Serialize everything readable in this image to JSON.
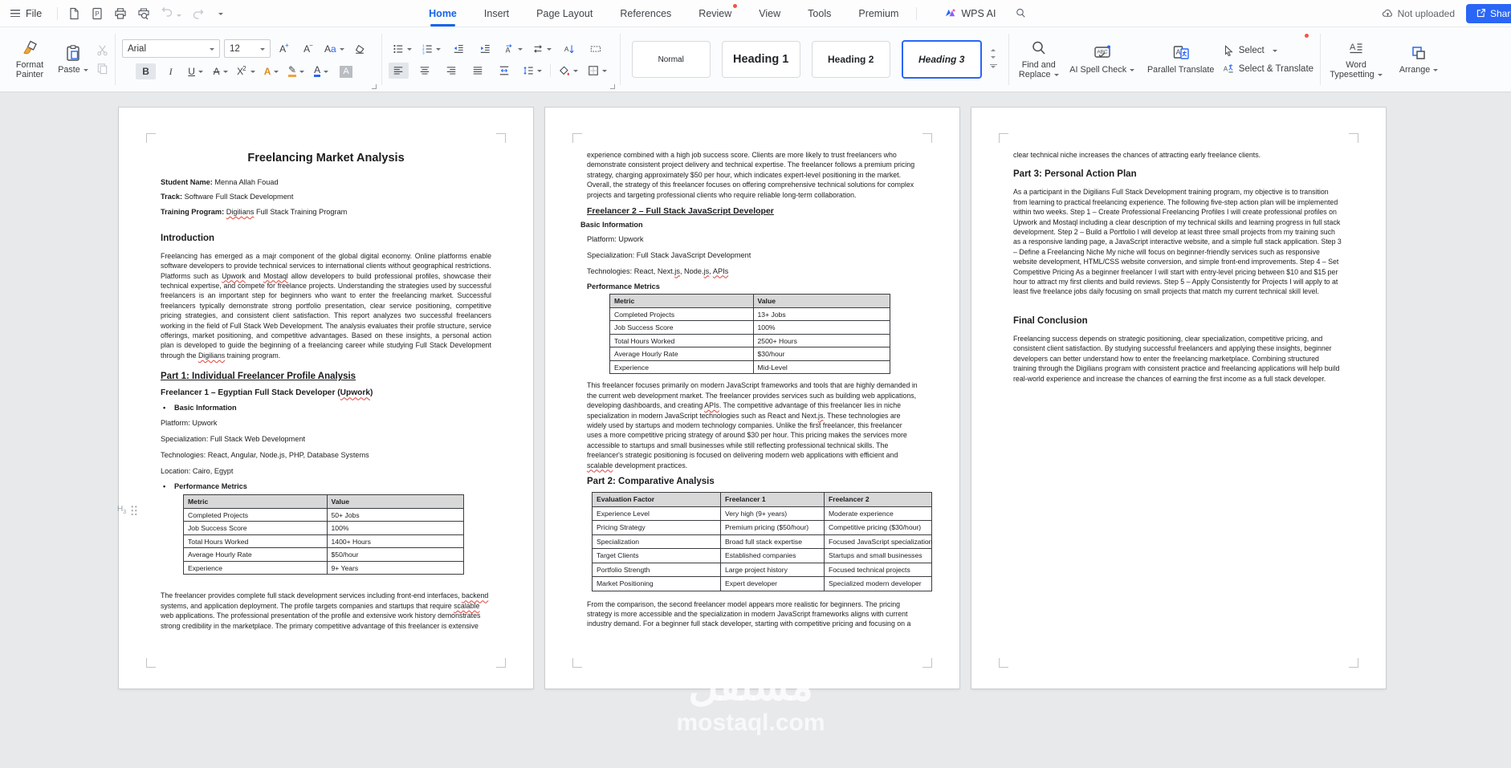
{
  "titlebar": {
    "file_label": "File",
    "tabs": [
      {
        "label": "Home",
        "active": true
      },
      {
        "label": "Insert"
      },
      {
        "label": "Page Layout"
      },
      {
        "label": "References"
      },
      {
        "label": "Review",
        "badge_dot": true
      },
      {
        "label": "View"
      },
      {
        "label": "Tools"
      },
      {
        "label": "Premium"
      }
    ],
    "wps_ai_label": "WPS AI",
    "upload_status": "Not uploaded",
    "share_label": "Share"
  },
  "ribbon": {
    "format_painter": "Format Painter",
    "paste": "Paste",
    "font_family": "Arial",
    "font_size": "12",
    "styles": [
      {
        "name": "Normal"
      },
      {
        "name": "Heading 1"
      },
      {
        "name": "Heading 2"
      },
      {
        "name": "Heading 3",
        "selected": true
      }
    ],
    "find_replace": "Find and Replace",
    "ai_spell_check": "AI Spell Check",
    "parallel_translate": "Parallel Translate",
    "select": "Select",
    "select_translate": "Select & Translate",
    "word_typesetting": "Word Typesetting",
    "arrange": "Arrange"
  },
  "margin_marker": "H3",
  "watermark": {
    "arabic": "مستقل",
    "latin": "mostaql.com"
  },
  "doc": {
    "page1": {
      "title": "Freelancing Market Analysis",
      "meta": [
        "**Student Name:** Menna Allah Fouad",
        "**Track:** Software Full Stack Development",
        "**Training Program:** «Digilians» Full Stack Training Program"
      ],
      "intro_heading": "Introduction",
      "intro": "Freelancing has emerged as a majr component of the global digital economy. Online platforms enable software developers to provide technical services to international clients without geographical restrictions. Platforms such as «Upwork» and «Mostaql» allow developers to build professional profiles, showcase their technical expertise, and compete for freelance projects. Understanding the strategies used by successful freelancers is an important step for beginners who want to enter the freelancing market. Successful freelancers typically demonstrate strong portfolio presentation, clear service positioning, competitive pricing strategies, and consistent client satisfaction. This report analyzes two successful freelancers working in the field of Full Stack Web Development. The analysis evaluates their profile structure, service offerings, market positioning, and competitive advantages. Based on these insights, a personal action plan is developed to guide the beginning of a freelancing career while studying Full Stack Development through the «Digilians» training program.",
      "part1_heading": "Part 1: Individual Freelancer Profile Analysis",
      "freelancer1_heading": "Freelancer 1 – Egyptian Full Stack Developer («Upwork»)",
      "basic_info_label": "Basic Information",
      "info": [
        "Platform: Upwork",
        "Specialization: Full Stack Web Development",
        "Technologies: React, Angular, Node.js, PHP, Database Systems",
        "Location: Cairo, Egypt"
      ],
      "metrics_label": "Performance Metrics",
      "metrics_table": {
        "headers": [
          "Metric",
          "Value"
        ],
        "rows": [
          [
            "Completed Projects",
            "50+ Jobs"
          ],
          [
            "Job Success Score",
            "100%"
          ],
          [
            "Total Hours Worked",
            "1400+ Hours"
          ],
          [
            "Average Hourly Rate",
            "$50/hour"
          ],
          [
            "Experience",
            "9+ Years"
          ]
        ]
      },
      "closing": "The freelancer provides complete full stack development services including front-end interfaces, «backend» systems, and application deployment. The profile targets companies and startups that require «scalable» web applications. The professional presentation of the profile and extensive work history demonstrates strong credibility in the marketplace. The primary competitive advantage of this freelancer is extensive"
    },
    "page2": {
      "continuation": "experience combined with a high job success score. Clients are more likely to trust freelancers who demonstrate consistent project delivery and technical expertise. The freelancer follows a premium pricing strategy, charging approximately $50 per hour, which indicates expert-level positioning in the market. Overall, the strategy of this freelancer focuses on offering comprehensive technical solutions for complex projects and targeting professional clients who require reliable long-term collaboration.",
      "freelancer2_heading": "Freelancer 2 – Full Stack JavaScript Developer",
      "basic_info_label": "Basic Information",
      "info": [
        "Platform: Upwork",
        "Specialization: Full Stack JavaScript Development",
        "Technologies: React, Next.«js», Node.«js», «APIs»"
      ],
      "metrics_label": "Performance Metrics",
      "metrics_table": {
        "headers": [
          "Metric",
          "Value"
        ],
        "rows": [
          [
            "Completed Projects",
            "13+ Jobs"
          ],
          [
            "Job Success Score",
            "100%"
          ],
          [
            "Total Hours Worked",
            "2500+ Hours"
          ],
          [
            "Average Hourly Rate",
            "$30/hour"
          ],
          [
            "Experience",
            "Mid-Level"
          ]
        ]
      },
      "analysis": "This freelancer focuses primarily on modern JavaScript frameworks and tools that are highly demanded in the current web development market. The freelancer provides services such as building web applications, developing dashboards, and creating «APIs». The competitive advantage of this freelancer lies in niche specialization in modern JavaScript technologies such as React and Next.«js». These technologies are widely used by startups and modern technology companies. Unlike the first freelancer, this freelancer uses a more competitive pricing strategy of around $30 per hour. This pricing makes the services more accessible to startups and small businesses while still reflecting professional technical skills. The freelancer's strategic positioning is focused on delivering modern web applications with efficient and «scalable» development practices.",
      "part2_heading": "Part 2: Comparative Analysis",
      "comparison_table": {
        "headers": [
          "Evaluation Factor",
          "Freelancer 1",
          "Freelancer 2"
        ],
        "rows": [
          [
            "Experience Level",
            "Very high (9+ years)",
            "Moderate experience"
          ],
          [
            "Pricing Strategy",
            "Premium pricing ($50/hour)",
            "Competitive pricing ($30/hour)"
          ],
          [
            "Specialization",
            "Broad full stack expertise",
            "Focused JavaScript specialization"
          ],
          [
            "Target Clients",
            "Established companies",
            "Startups and small businesses"
          ],
          [
            "Portfolio Strength",
            "Large project history",
            "Focused technical projects"
          ],
          [
            "Market Positioning",
            "Expert developer",
            "Specialized modern developer"
          ]
        ]
      },
      "conclusion": "From the comparison, the second freelancer model appears more realistic for beginners. The pricing strategy is more accessible and the specialization in modern JavaScript frameworks aligns with current industry demand. For a beginner full stack developer, starting with competitive pricing and focusing on a"
    },
    "page3": {
      "continuation": "clear technical niche increases the chances of attracting early freelance clients.",
      "part3_heading": "Part 3: Personal Action Plan",
      "action_plan": "As a participant in the Digilians Full Stack Development training program, my objective is to transition from learning to practical freelancing experience. The following five-step action plan will be implemented within two weeks. Step 1 – Create Professional Freelancing Profiles I will create professional profiles on Upwork and Mostaql including a clear description of my technical skills and learning progress in full stack development. Step 2 – Build a Portfolio I will develop at least three small projects from my training such as a responsive landing page, a JavaScript interactive website, and a simple full stack application. Step 3 – Define a Freelancing Niche My niche will focus on beginner-friendly services such as responsive website development, HTML/CSS website conversion, and simple front-end improvements. Step 4 – Set Competitive Pricing As a beginner freelancer I will start with entry-level pricing between $10 and $15 per hour to attract my first clients and build reviews. Step 5 – Apply Consistently for Projects I will apply to at least five freelance jobs daily focusing on small projects that match my current technical skill level.",
      "final_heading": "Final Conclusion",
      "final": "Freelancing success depends on strategic positioning, clear specialization, competitive pricing, and consistent client satisfaction. By studying successful freelancers and applying these insights, beginner developers can better understand how to enter the freelancing marketplace. Combining structured training through the Digilians program with consistent practice and freelancing applications will help build real-world experience and increase the chances of earning the first income as a full stack developer."
    }
  }
}
